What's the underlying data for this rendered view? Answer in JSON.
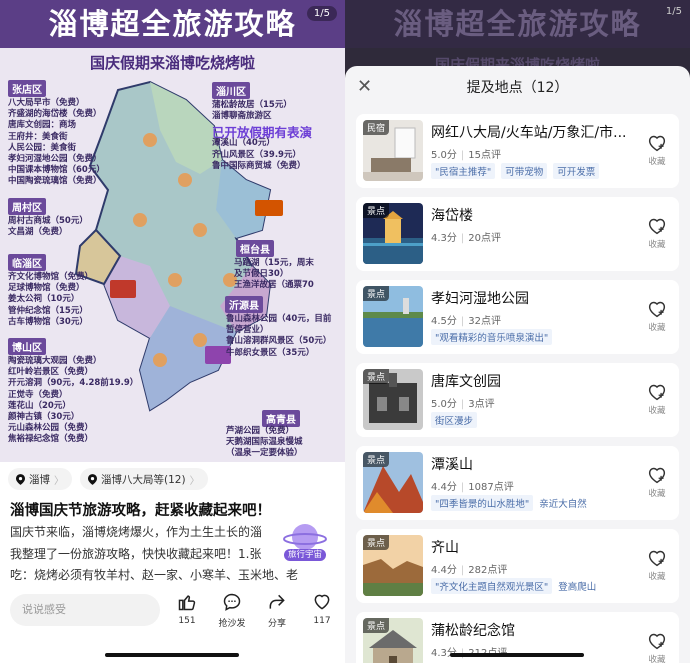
{
  "poster": {
    "title": "淄博超全旅游攻略",
    "subtitle": "国庆假期来淄博吃烧烤啦",
    "image_counter": "1/5",
    "highlight": "已开放假期有表演",
    "regions": [
      {
        "name": "张店区",
        "items": [
          "八大局早市（免费）",
          "齐盛湖的海岱楼（免费）",
          "唐库文创园：商场",
          "王府井：美食街",
          "人民公园：美食街",
          "孝妇河湿地公园（免费）",
          "中国课本博物馆（60元）",
          "中国陶瓷琉璃馆（免费）"
        ]
      },
      {
        "name": "周村区",
        "items": [
          "周村古商城（50元）",
          "文昌湖（免费）"
        ]
      },
      {
        "name": "临淄区",
        "items": [
          "齐文化博物馆（免费）",
          "足球博物馆（免费）",
          "姜太公祠（10元）",
          "管仲纪念馆（15元）",
          "古车博物馆（30元）"
        ]
      },
      {
        "name": "博山区",
        "items": [
          "陶瓷琉璃大观园（免费）",
          "红叶岭岩景区（免费）",
          "开元溶洞（90元，4.28前19.9）",
          "正觉寺（免费）",
          "莲花山（20元）",
          "颜神古镇（30元）",
          "元山森林公园（免费）",
          "焦裕禄纪念馆（免费）"
        ]
      },
      {
        "name": "淄川区",
        "items": [
          "蒲松龄故居（15元）",
          "淄博聊斋旅游区",
          "",
          "潭溪山（40元）",
          "齐山风景区（39.9元）",
          "鲁中国际商贸城（免费）"
        ]
      },
      {
        "name": "桓台县",
        "items": [
          "马踏湖（15元，周末",
          "及节假日30）",
          "王渔洋故居（通票70"
        ]
      },
      {
        "name": "沂源县",
        "items": [
          "鲁山森林公园（40元，目前",
          "暂停营业）",
          "鲁山溶洞群风景区（50元）",
          "牛郎织女景区（35元）"
        ]
      },
      {
        "name": "高青县",
        "items": [
          "芦湖公园（免费）",
          "天鹅湖国际温泉慢城",
          "（温泉一定要体验）"
        ]
      }
    ]
  },
  "tags": [
    "淄博",
    "淄博八大局等(12)"
  ],
  "note": {
    "title": "淄博国庆节旅游攻略，赶紧收藏起来吧！",
    "lines": [
      "国庆节来临，淄博烧烤爆火，作为土生土长的淄",
      "我整理了一份旅游攻略，快快收藏起来吧！1.张",
      "吃：烧烤必须有牧羊村、赵一家、小寒羊、玉米地、老"
    ],
    "ai_badge": "旅行宇宙"
  },
  "bottom_bar": {
    "comment_placeholder": "说说感受",
    "like_count": "151",
    "comment_label": "抢沙发",
    "share_label": "分享",
    "fav_count": "117"
  },
  "sheet": {
    "background_title": "淄博超全旅游攻略",
    "background_subtitle": "国庆假期来淄博吃烧烤啦",
    "background_counter": "1/5",
    "title": "提及地点（12）",
    "fav_label": "收藏",
    "places": [
      {
        "type": "民宿",
        "name": "网红八大局/火车站/万象汇/市...",
        "score": "5.0分",
        "reviews": "15点评",
        "chips": [
          "\"民宿主推荐\"",
          "可带宠物",
          "可开发票"
        ],
        "plain": [],
        "thumb": "room"
      },
      {
        "type": "景点",
        "name": "海岱楼",
        "score": "4.3分",
        "reviews": "20点评",
        "chips": [],
        "plain": [],
        "thumb": "tower"
      },
      {
        "type": "景点",
        "name": "孝妇河湿地公园",
        "score": "4.5分",
        "reviews": "32点评",
        "chips": [
          "\"观看精彩的音乐喷泉演出\""
        ],
        "plain": [],
        "thumb": "lake"
      },
      {
        "type": "景点",
        "name": "唐库文创园",
        "score": "5.0分",
        "reviews": "3点评",
        "chips": [
          "街区漫步"
        ],
        "plain": [],
        "thumb": "factory"
      },
      {
        "type": "景点",
        "name": "潭溪山",
        "score": "4.4分",
        "reviews": "1087点评",
        "chips": [
          "\"四季皆景的山水胜地\""
        ],
        "plain": [
          "亲近大自然"
        ],
        "thumb": "mountain"
      },
      {
        "type": "景点",
        "name": "齐山",
        "score": "4.4分",
        "reviews": "282点评",
        "chips": [
          "\"齐文化主题自然观光景区\""
        ],
        "plain": [
          "登高爬山"
        ],
        "thumb": "cliff"
      },
      {
        "type": "景点",
        "name": "蒲松龄纪念馆",
        "score": "4.3分",
        "reviews": "212点评",
        "chips": [],
        "plain": [],
        "thumb": "house"
      }
    ]
  },
  "colors": {
    "poster_purple": "#5b3e86",
    "region_tag": "#6b4a9b",
    "chip_blue": "#4a6da8"
  }
}
